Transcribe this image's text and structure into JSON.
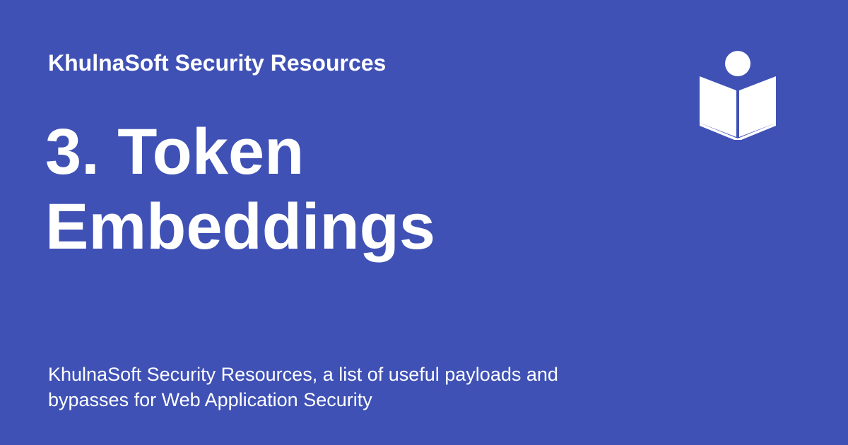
{
  "card": {
    "site_name": "KhulnaSoft Security Resources",
    "title_line_1": "3. Token",
    "title_line_2": "Embeddings",
    "description": "KhulnaSoft Security Resources, a list of useful payloads and bypasses for Web Application Security",
    "logo_icon": "book-reader-icon"
  },
  "colors": {
    "background": "#3f51b5",
    "text": "#ffffff"
  }
}
